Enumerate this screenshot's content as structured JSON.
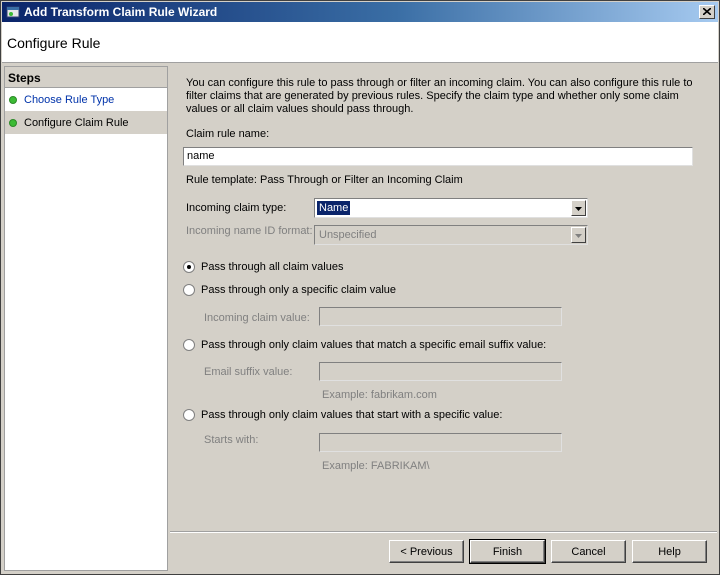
{
  "window": {
    "title": "Add Transform Claim Rule Wizard",
    "close_symbol": "x"
  },
  "header": {
    "page_title": "Configure Rule"
  },
  "steps": {
    "heading": "Steps",
    "items": [
      {
        "label": "Choose Rule Type",
        "state": "completed"
      },
      {
        "label": "Configure Claim Rule",
        "state": "current"
      }
    ]
  },
  "form": {
    "description": "You can configure this rule to pass through or filter an incoming claim. You can also configure this rule to filter claims that are generated by previous rules. Specify the claim type and whether only some claim values or all claim values should pass through.",
    "claim_rule_name_label": "Claim rule name:",
    "claim_rule_name_value": "name",
    "rule_template": "Rule template: Pass Through or Filter an Incoming Claim",
    "incoming_claim_type_label": "Incoming claim type:",
    "incoming_claim_type_value": "Name",
    "incoming_name_id_label": "Incoming name ID format:",
    "incoming_name_id_value": "Unspecified",
    "options": {
      "all_values": "Pass through all claim values",
      "specific_value": "Pass through only a specific claim value",
      "email_suffix": "Pass through only claim values that match a specific email suffix value:",
      "starts_with": "Pass through only claim values that start with a specific value:"
    },
    "selected_option": "all_values",
    "incoming_claim_value_label": "Incoming claim value:",
    "email_suffix_label": "Email suffix value:",
    "email_example": "Example: fabrikam.com",
    "starts_with_label": "Starts with:",
    "starts_with_example": "Example: FABRIKAM\\"
  },
  "buttons": {
    "previous": "< Previous",
    "finish": "Finish",
    "cancel": "Cancel",
    "help": "Help"
  },
  "icons": {
    "title": "wizard-window-icon",
    "close": "close-icon",
    "step_status": "green-dot-icon",
    "dropdown": "chevron-down-icon"
  },
  "colors": {
    "titlebar_start": "#0a246a",
    "titlebar_end": "#a6caf0",
    "step_dot": "#3cbb35",
    "link": "#0033aa",
    "selection": "#0a246a",
    "face": "#d4d0c8"
  }
}
